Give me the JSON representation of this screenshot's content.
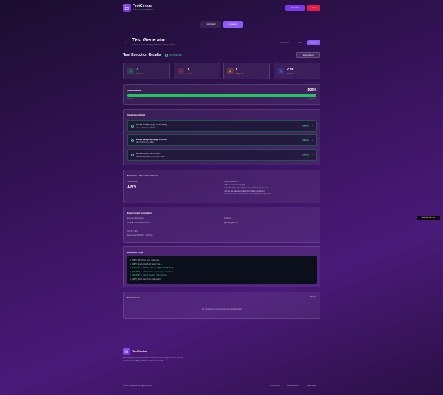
{
  "header": {
    "brand": "TestGenius",
    "tagline": "AI Powered Testing Platform",
    "about_label": "AboutTGS",
    "logout_label": "Logout"
  },
  "nav": {
    "dashboard": "Dashboard",
    "generator": "Generator"
  },
  "page": {
    "title": "Test Generator",
    "subtitle": "Generate AI-powered Playwright tests for any website",
    "tabs": [
      "Generator",
      "Code",
      "Results"
    ],
    "active_tab": "Results"
  },
  "results": {
    "title": "Test Execution Results",
    "status": "COMPLETED",
    "export_label": "Export Report"
  },
  "stats": [
    {
      "value": "3",
      "label": "Passed",
      "color": "#22c55e",
      "icon": "check-circle-icon"
    },
    {
      "value": "0",
      "label": "Failed",
      "color": "#ef4444",
      "icon": "x-circle-icon"
    },
    {
      "value": "0",
      "label": "Skipped",
      "color": "#f59e0b",
      "icon": "skip-icon"
    },
    {
      "value": "2.9s",
      "label": "Duration",
      "color": "#3b82f6",
      "icon": "clock-icon"
    }
  ],
  "success": {
    "title": "Success Rate",
    "percent": "100%",
    "fill": 1.0,
    "left_label": "3 passed",
    "right_label": "3 total tests"
  },
  "details": {
    "title": "Test Cases Details",
    "cases": [
      {
        "name": "should load the page successfully",
        "meta": "body • 5:35:31 pm • 1481ms",
        "badge": "PASSED"
      },
      {
        "name": "should have proper page structure",
        "meta": "html • 5:35:31 pm • 690ms",
        "badge": "PASSED"
      },
      {
        "name": "should handle interactions",
        "meta": "interactive elements • 5:35:31 pm • 636ms",
        "badge": "PASSED"
      }
    ]
  },
  "summary": {
    "title": "Summary & Recommendations",
    "rate_label": "Success Rate",
    "rate_value": "100%",
    "rec_label": "Recommendations",
    "recommendations": [
      "• All tests passed successfully",
      "• Consider adding more specific test scenarios for your use case",
      "• Use the generated test code in your testing environment",
      "• Customize test assertions based on your application requirements"
    ]
  },
  "environment": {
    "title": "Environment Information",
    "exec_label": "Execution Environment",
    "exec_value": "Full Server Environment",
    "url_label": "Test Target",
    "url_value": "https://google.com",
    "id_label": "Test ID / Object",
    "executed": "Executed at: 30/8/2025, 5:35:31 pm"
  },
  "logs": {
    "title": "Execution Logs",
    "lines": [
      {
        "text": "> [INFO] Starting test execution",
        "color": "#d1d5db"
      },
      {
        "text": "> [INFO] Analyzing test scenarios...",
        "color": "#d1d5db"
      },
      {
        "text": "> [SUCCESS] ✓ should load the page successfully",
        "color": "#4ade80"
      },
      {
        "text": "> [SUCCESS] ✓ should have proper page structure",
        "color": "#4ade80"
      },
      {
        "text": "> [SUCCESS] ✓ should handle interactions",
        "color": "#4ade80"
      },
      {
        "text": "> [INFO] Test execution completed",
        "color": "#d1d5db"
      }
    ]
  },
  "screenshots": {
    "title": "Screenshots",
    "count": "0 captured",
    "empty": "No screenshots captured during this test execution"
  },
  "built_with": {
    "prefix": "Built with",
    "name": "Bolt.new"
  },
  "footer": {
    "brand": "TestGenius",
    "description": "Transform your testing workflow with AI-powered test generation. Create comprehensive Playwright test suites in seconds.",
    "copyright": "© 2025 TestGenius. All rights reserved.",
    "links": [
      "Privacy Policy",
      "Terms of Service",
      "Cookie Policy"
    ]
  }
}
